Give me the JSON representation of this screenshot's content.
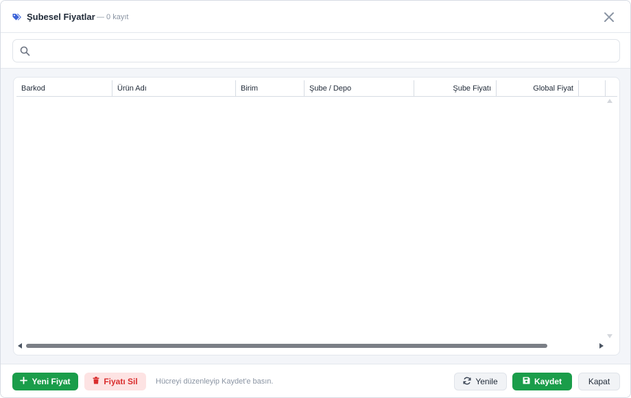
{
  "window": {
    "title": "Şubesel Fiyatlar",
    "record_count": "— 0 kayıt"
  },
  "search": {
    "value": "",
    "placeholder": ""
  },
  "grid": {
    "columns": [
      "Barkod",
      "Ürün Adı",
      "Birim",
      "Şube / Depo",
      "Şube Fiyatı",
      "Global Fiyat"
    ],
    "rows": []
  },
  "footer": {
    "new_price_label": "Yeni Fiyat",
    "delete_price_label": "Fiyatı Sil",
    "hint": "Hücreyi düzenleyip Kaydet'e basın.",
    "refresh_label": "Yenile",
    "save_label": "Kaydet",
    "close_label": "Kapat"
  },
  "colors": {
    "accent_blue": "#3b63d8",
    "success_green": "#1a9d4a",
    "danger_red": "#d92d2d",
    "danger_bg": "#fde3e3"
  },
  "icons": {
    "title": "tags-icon",
    "close": "close-icon",
    "search": "search-icon",
    "new": "plus-icon",
    "delete": "trash-icon",
    "refresh": "refresh-icon",
    "save": "floppy-disk-icon"
  }
}
